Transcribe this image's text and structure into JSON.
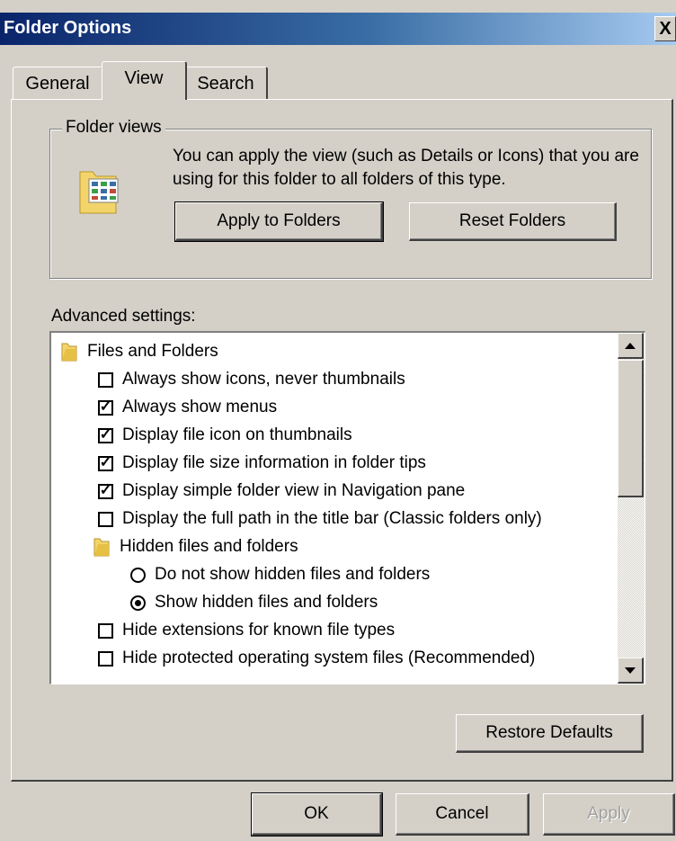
{
  "window": {
    "title": "Folder Options",
    "close_glyph": "X"
  },
  "tabs": [
    {
      "label": "General",
      "active": false
    },
    {
      "label": "View",
      "active": true
    },
    {
      "label": "Search",
      "active": false
    }
  ],
  "folder_views": {
    "legend": "Folder views",
    "description": "You can apply the view (such as Details or Icons) that you are using for this folder to all folders of this type.",
    "apply_button": "Apply to Folders",
    "reset_button": "Reset Folders"
  },
  "advanced": {
    "label": "Advanced settings:",
    "items": [
      {
        "type": "folder",
        "label": "Files and Folders"
      },
      {
        "type": "checkbox",
        "checked": false,
        "label": "Always show icons, never thumbnails"
      },
      {
        "type": "checkbox",
        "checked": true,
        "label": "Always show menus"
      },
      {
        "type": "checkbox",
        "checked": true,
        "label": "Display file icon on thumbnails"
      },
      {
        "type": "checkbox",
        "checked": true,
        "label": "Display file size information in folder tips"
      },
      {
        "type": "checkbox",
        "checked": true,
        "label": "Display simple folder view in Navigation pane"
      },
      {
        "type": "checkbox",
        "checked": false,
        "label": "Display the full path in the title bar (Classic folders only)"
      },
      {
        "type": "folder",
        "label": "Hidden files and folders"
      },
      {
        "type": "radio",
        "checked": false,
        "label": "Do not show hidden files and folders"
      },
      {
        "type": "radio",
        "checked": true,
        "label": "Show hidden files and folders"
      },
      {
        "type": "checkbox",
        "checked": false,
        "label": "Hide extensions for known file types"
      },
      {
        "type": "checkbox",
        "checked": false,
        "label": "Hide protected operating system files (Recommended)"
      }
    ],
    "restore_button": "Restore Defaults"
  },
  "footer": {
    "ok": "OK",
    "cancel": "Cancel",
    "apply": "Apply"
  },
  "colors": {
    "title_gradient_start": "#0a246a",
    "title_gradient_end": "#a6caf0",
    "face": "#d4d0c8",
    "folder": "#f2d46a"
  }
}
